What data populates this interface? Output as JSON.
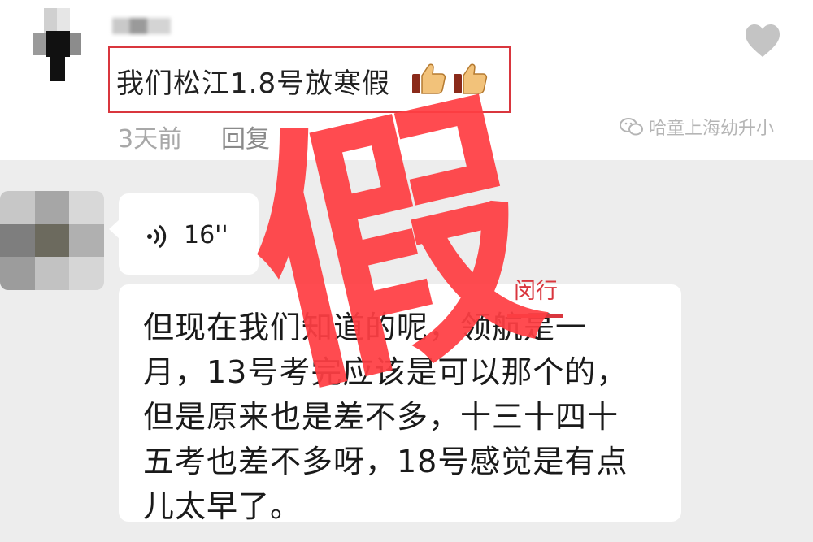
{
  "comment": {
    "text": "我们松江1.8号放寒假",
    "emoji": "👍👍",
    "time": "3天前",
    "reply_label": "回复"
  },
  "watermark": {
    "icon": "wechat-icon",
    "text": "哈童上海幼升小"
  },
  "voice_message": {
    "icon": "voice-wave-icon",
    "duration": "16''"
  },
  "text_message": {
    "lines": [
      "但现在我们知道的呢，领航是一",
      "月，13号考完应该是可以那个的，",
      "但是原来也是差不多，十三十四十",
      "五考也差不多呀，18号感觉是有点",
      "儿太早了。"
    ],
    "correction": "闵行"
  },
  "stamp": {
    "text": "假"
  },
  "colors": {
    "highlight_red": "#d9363e",
    "stamp_red": "#ff3e43",
    "chat_background": "#ededed"
  }
}
